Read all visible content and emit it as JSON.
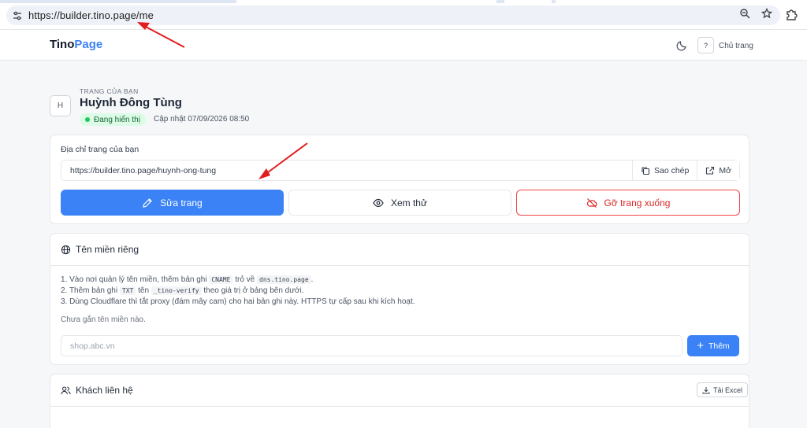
{
  "browser": {
    "url": "https://builder.tino.page/me",
    "site_info_icon": "tune-icon",
    "zoom_icon": "zoom-icon",
    "bookmark_icon": "star-icon",
    "extensions_icon": "puzzle-icon"
  },
  "header": {
    "brand_part1": "Tino",
    "brand_part2": "Page",
    "theme_icon": "moon-icon",
    "help_label": "?",
    "home_link": "Chủ trang"
  },
  "profile": {
    "avatar_initial": "H",
    "eyebrow": "TRANG CỦA BẠN",
    "name": "Huỳnh Đông Tùng",
    "status": "Đang hiển thị",
    "updated": "Cập nhật 07/09/2026 08:50"
  },
  "address_card": {
    "label": "Địa chỉ trang của bạn",
    "url": "https://builder.tino.page/huynh-ong-tung",
    "copy_label": "Sao chép",
    "open_label": "Mở",
    "edit_label": "Sửa trang",
    "preview_label": "Xem thử",
    "unpublish_label": "Gỡ trang xuống"
  },
  "domain_card": {
    "title": "Tên miền riêng",
    "step1_a": "1. Vào nơi quản lý tên miền, thêm bản ghi",
    "step1_code1": "CNAME",
    "step1_b": "trỏ về",
    "step1_code2": "dns.tino.page",
    "step1_c": ".",
    "step2_a": "2. Thêm bản ghi",
    "step2_code1": "TXT",
    "step2_b": "tên",
    "step2_code2": "_tino-verify",
    "step2_c": "theo giá trị ở bảng bên dưới.",
    "step3": "3. Dùng Cloudflare thì tắt proxy (đám mây cam) cho hai bản ghi này. HTTPS tự cấp sau khi kích hoạt.",
    "empty_text": "Chưa gắn tên miền nào.",
    "input_placeholder": "shop.abc.vn",
    "add_label": "Thêm"
  },
  "contacts_card": {
    "title": "Khách liên hệ",
    "export_label": "Tải Excel"
  },
  "colors": {
    "accent": "#3b82f6",
    "danger": "#dc2626",
    "success_bg": "#dcfce7",
    "success_text": "#166534",
    "annotation": "#e11d1d"
  }
}
